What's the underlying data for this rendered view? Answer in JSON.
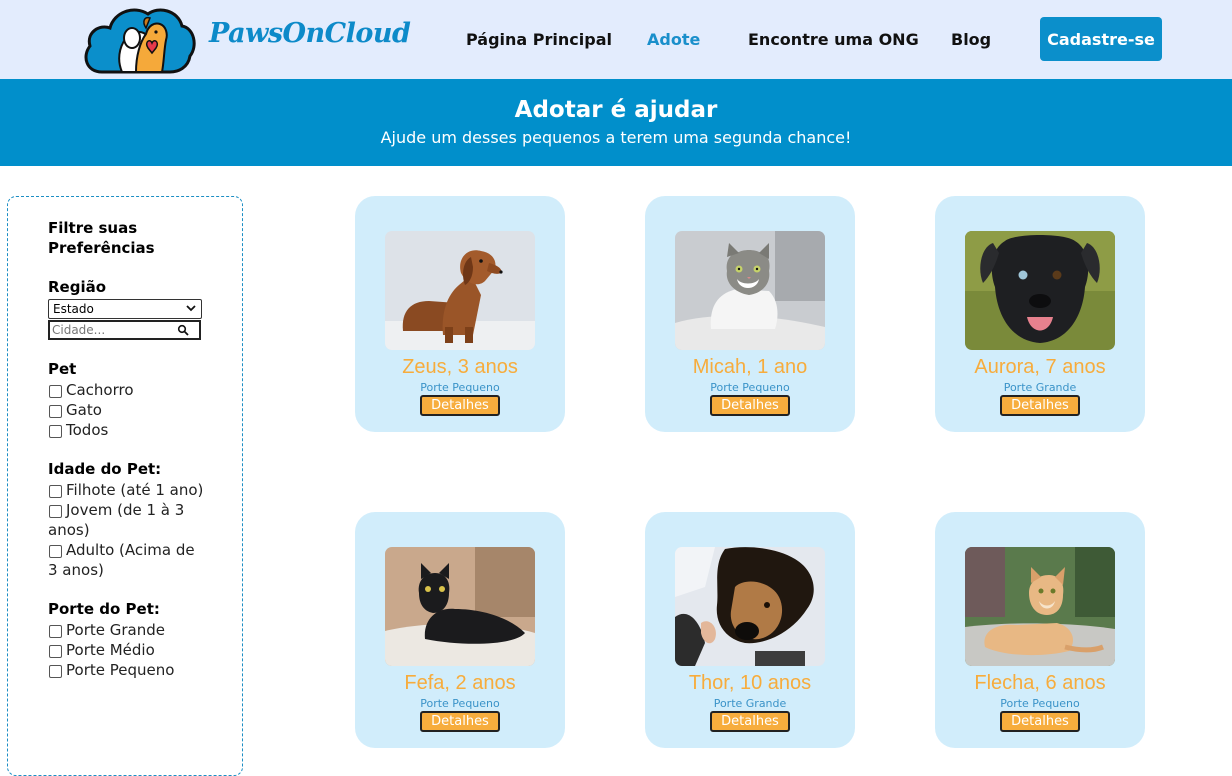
{
  "header": {
    "logo_text": "PawsOnCloud",
    "nav": [
      "Página Principal",
      "Adote",
      "Encontre uma ONG",
      "Blog"
    ],
    "active_nav": "Adote",
    "signup_label": "Cadastre-se"
  },
  "banner": {
    "title": "Adotar é ajudar",
    "subtitle": "Ajude um desses pequenos a terem uma segunda chance!"
  },
  "sidebar": {
    "title": "Filtre suas Preferências",
    "region_title": "Região",
    "state_select": "Estado",
    "city_placeholder": "Cidade...",
    "pet_title": "Pet",
    "pet_options": [
      "Cachorro",
      "Gato",
      "Todos"
    ],
    "age_title": "Idade do Pet:",
    "age_options": [
      "Filhote (até 1 ano)",
      "Jovem (de 1 à 3 anos)",
      "Adulto (Acima de 3 anos)"
    ],
    "size_title": "Porte do Pet:",
    "size_options": [
      "Porte Grande",
      "Porte Médio",
      "Porte Pequeno"
    ]
  },
  "pets": [
    {
      "name": "Zeus, 3 anos",
      "size": "Porte Pequeno",
      "button": "Detalhes",
      "photo": "dachshund-dog"
    },
    {
      "name": "Micah, 1 ano",
      "size": "Porte Pequeno",
      "button": "Detalhes",
      "photo": "tabby-white-cat"
    },
    {
      "name": "Aurora, 7 anos",
      "size": "Porte Grande",
      "button": "Detalhes",
      "photo": "black-dog"
    },
    {
      "name": "Fefa, 2 anos",
      "size": "Porte Pequeno",
      "button": "Detalhes",
      "photo": "black-cat"
    },
    {
      "name": "Thor, 10 anos",
      "size": "Porte Grande",
      "button": "Detalhes",
      "photo": "brown-black-dog-in-snow"
    },
    {
      "name": "Flecha, 6 anos",
      "size": "Porte Pequeno",
      "button": "Detalhes",
      "photo": "orange-cat"
    }
  ],
  "colors": {
    "header_bg": "#e3ecfd",
    "brand_blue": "#0b8fcb",
    "banner_bg": "#018fcb",
    "card_bg": "#d1edfb",
    "accent_orange": "#f7ad3d"
  }
}
